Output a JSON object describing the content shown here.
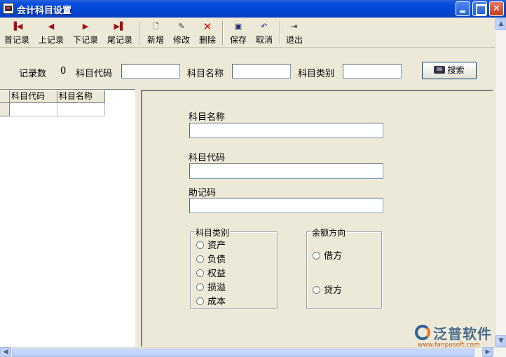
{
  "window": {
    "title": "会计科目设置"
  },
  "toolbar": {
    "first": "首记录",
    "prev": "上记录",
    "next": "下记录",
    "last": "尾记录",
    "new": "新增",
    "edit": "修改",
    "delete": "删除",
    "save": "保存",
    "cancel": "取消",
    "exit": "退出"
  },
  "search": {
    "count_label": "记录数",
    "count_value": "0",
    "code_label": "科目代码",
    "code_value": "",
    "name_label": "科目名称",
    "name_value": "",
    "type_label": "科目类别",
    "type_value": "",
    "button_label": "搜索"
  },
  "grid": {
    "columns": [
      "科目代码",
      "科目名称"
    ]
  },
  "form": {
    "name_label": "科目名称",
    "name_value": "",
    "code_label": "科目代码",
    "code_value": "",
    "memo_label": "助记码",
    "memo_value": "",
    "category": {
      "title": "科目类别",
      "options": [
        "资产",
        "负债",
        "权益",
        "损溢",
        "成本"
      ]
    },
    "balance": {
      "title": "余额方向",
      "options": [
        "借方",
        "贷方"
      ]
    }
  },
  "watermark": {
    "name": "泛普软件",
    "url": "www.fanpusoft.com"
  },
  "icons": {
    "first": "first-record-icon",
    "prev": "prev-record-icon",
    "next": "next-record-icon",
    "last": "last-record-icon",
    "new": "new-doc-icon",
    "edit": "edit-icon",
    "delete": "delete-x-icon",
    "save": "floppy-save-icon",
    "cancel": "undo-icon",
    "exit": "exit-door-icon",
    "search": "binoculars-icon"
  }
}
